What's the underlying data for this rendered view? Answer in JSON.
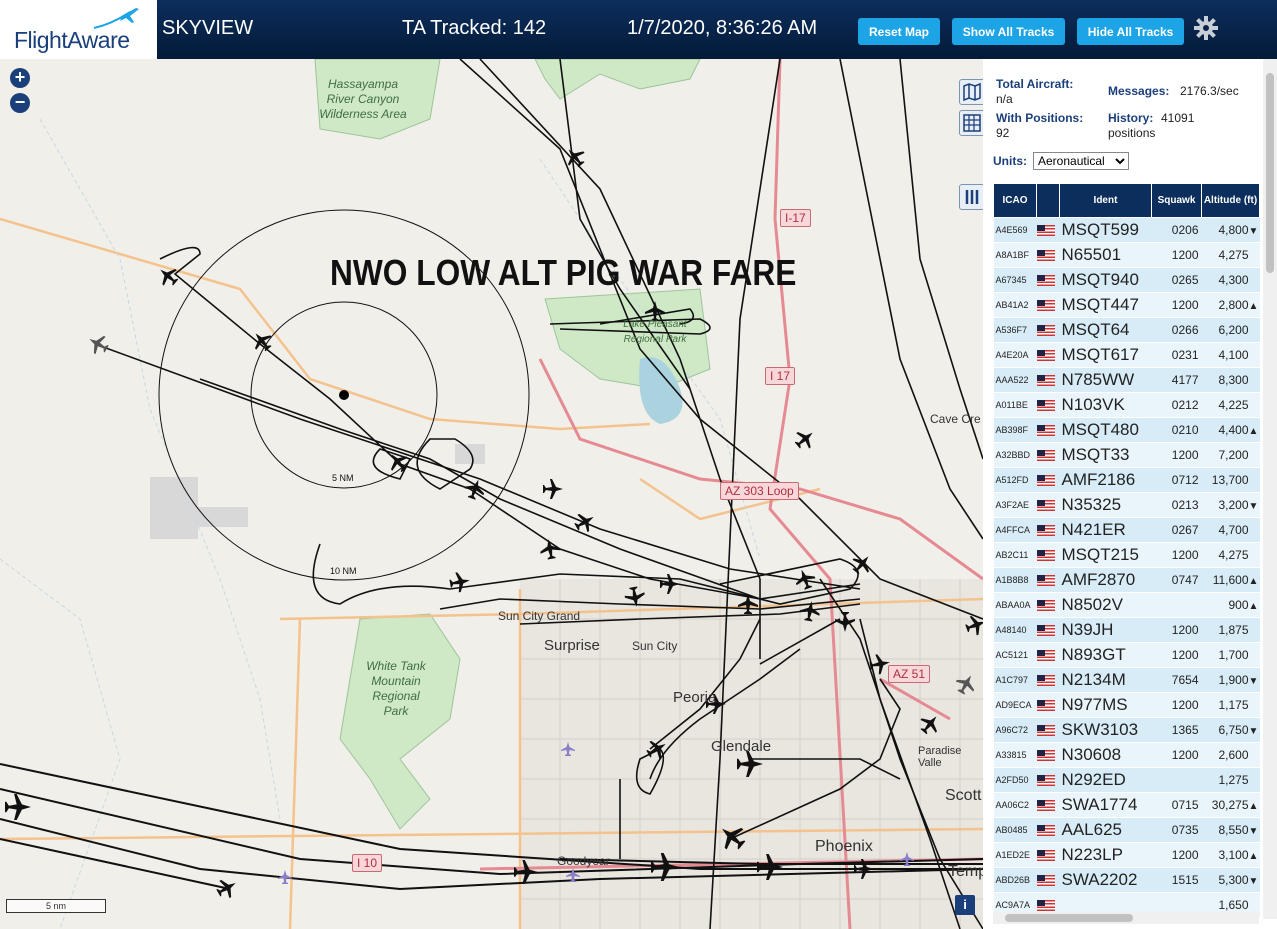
{
  "header": {
    "logo_text": "FlightAware",
    "app_name": "SKYVIEW",
    "ta_tracked": "TA Tracked: 142",
    "datetime": "1/7/2020, 8:36:26 AM",
    "reset_map": "Reset Map",
    "show_all_tracks": "Show All Tracks",
    "hide_all_tracks": "Hide All Tracks",
    "settings_icon": "gear-icon"
  },
  "map": {
    "zoom_in": "+",
    "zoom_out": "−",
    "overlay_title": "NWO LOW ALT PIG WAR FARE",
    "ring_5nm": "5 NM",
    "ring_10nm": "10 NM",
    "scale": "5 nm",
    "info": "i",
    "places": {
      "surprise": "Surprise",
      "sun_city": "Sun City",
      "sun_city_grand": "Sun City Grand",
      "peoria": "Peoria",
      "glendale": "Glendale",
      "phoenix": "Phoenix",
      "goodyear": "Goodyear",
      "cave_creek": "Cave Cre",
      "paradise_valley": "Paradise Valle",
      "scottsdale": "Scott",
      "tempe": "Temp"
    },
    "parks": {
      "hassayampa": "Hassayampa River Canyon Wilderness Area",
      "white_tank": "White Tank Mountain Regional Park",
      "lake_pleasant": "Lake Pleasant Regional Park"
    },
    "highways": {
      "i17a": "I-17",
      "i17b": "I 17",
      "az303": "AZ 303 Loop",
      "az51": "AZ 51",
      "i10": "I 10"
    }
  },
  "sidebar": {
    "total_aircraft_label": "Total Aircraft:",
    "total_aircraft_value": "n/a",
    "messages_label": "Messages:",
    "messages_value": "2176.3/sec",
    "with_positions_label": "With Positions:",
    "with_positions_value": "92",
    "history_label": "History:",
    "history_value": "41091 positions",
    "units_label": "Units:",
    "units_value": "Aeronautical",
    "columns": [
      "ICAO",
      "",
      "Ident",
      "Squawk",
      "Altitude (ft)"
    ],
    "rows": [
      {
        "icao": "A4E569",
        "ident": "MSQT599",
        "squawk": "0206",
        "alt": "4,800",
        "trend": "▼"
      },
      {
        "icao": "A8A1BF",
        "ident": "N65501",
        "squawk": "1200",
        "alt": "4,275",
        "trend": ""
      },
      {
        "icao": "A67345",
        "ident": "MSQT940",
        "squawk": "0265",
        "alt": "4,300",
        "trend": ""
      },
      {
        "icao": "AB41A2",
        "ident": "MSQT447",
        "squawk": "1200",
        "alt": "2,800",
        "trend": "▲"
      },
      {
        "icao": "A536F7",
        "ident": "MSQT64",
        "squawk": "0266",
        "alt": "6,200",
        "trend": ""
      },
      {
        "icao": "A4E20A",
        "ident": "MSQT617",
        "squawk": "0231",
        "alt": "4,100",
        "trend": ""
      },
      {
        "icao": "AAA522",
        "ident": "N785WW",
        "squawk": "4177",
        "alt": "8,300",
        "trend": ""
      },
      {
        "icao": "A011BE",
        "ident": "N103VK",
        "squawk": "0212",
        "alt": "4,225",
        "trend": ""
      },
      {
        "icao": "AB398F",
        "ident": "MSQT480",
        "squawk": "0210",
        "alt": "4,400",
        "trend": "▲"
      },
      {
        "icao": "A32BBD",
        "ident": "MSQT33",
        "squawk": "1200",
        "alt": "7,200",
        "trend": ""
      },
      {
        "icao": "A512FD",
        "ident": "AMF2186",
        "squawk": "0712",
        "alt": "13,700",
        "trend": ""
      },
      {
        "icao": "A3F2AE",
        "ident": "N35325",
        "squawk": "0213",
        "alt": "3,200",
        "trend": "▼"
      },
      {
        "icao": "A4FFCA",
        "ident": "N421ER",
        "squawk": "0267",
        "alt": "4,700",
        "trend": ""
      },
      {
        "icao": "AB2C11",
        "ident": "MSQT215",
        "squawk": "1200",
        "alt": "4,275",
        "trend": ""
      },
      {
        "icao": "A1B8B8",
        "ident": "AMF2870",
        "squawk": "0747",
        "alt": "11,600",
        "trend": "▲"
      },
      {
        "icao": "ABAA0A",
        "ident": "N8502V",
        "squawk": "",
        "alt": "900",
        "trend": "▲"
      },
      {
        "icao": "A48140",
        "ident": "N39JH",
        "squawk": "1200",
        "alt": "1,875",
        "trend": ""
      },
      {
        "icao": "AC5121",
        "ident": "N893GT",
        "squawk": "1200",
        "alt": "1,700",
        "trend": ""
      },
      {
        "icao": "A1C797",
        "ident": "N2134M",
        "squawk": "7654",
        "alt": "1,900",
        "trend": "▼"
      },
      {
        "icao": "AD9ECA",
        "ident": "N977MS",
        "squawk": "1200",
        "alt": "1,175",
        "trend": ""
      },
      {
        "icao": "A96C72",
        "ident": "SKW3103",
        "squawk": "1365",
        "alt": "6,750",
        "trend": "▼"
      },
      {
        "icao": "A33815",
        "ident": "N30608",
        "squawk": "1200",
        "alt": "2,600",
        "trend": ""
      },
      {
        "icao": "A2FD50",
        "ident": "N292ED",
        "squawk": "",
        "alt": "1,275",
        "trend": ""
      },
      {
        "icao": "AA06C2",
        "ident": "SWA1774",
        "squawk": "0715",
        "alt": "30,275",
        "trend": "▲"
      },
      {
        "icao": "AB0485",
        "ident": "AAL625",
        "squawk": "0735",
        "alt": "8,550",
        "trend": "▼"
      },
      {
        "icao": "A1ED2E",
        "ident": "N223LP",
        "squawk": "1200",
        "alt": "3,100",
        "trend": "▲"
      },
      {
        "icao": "ABD26B",
        "ident": "SWA2202",
        "squawk": "1515",
        "alt": "5,300",
        "trend": "▼"
      },
      {
        "icao": "AC9A7A",
        "ident": "",
        "squawk": "",
        "alt": "1,650",
        "trend": ""
      }
    ]
  },
  "colors": {
    "header_bg": "#0c2e5c",
    "button_bg": "#1ca4e6",
    "map_bg": "#f1efe9",
    "park_green": "#cfe8c6",
    "water": "#aad3df",
    "road_orange": "#f4c28d",
    "urban_grid": "#d9d4cc",
    "table_header": "#0c2e5c",
    "row_a": "#d8ecf7",
    "row_b": "#eaf5fb"
  }
}
